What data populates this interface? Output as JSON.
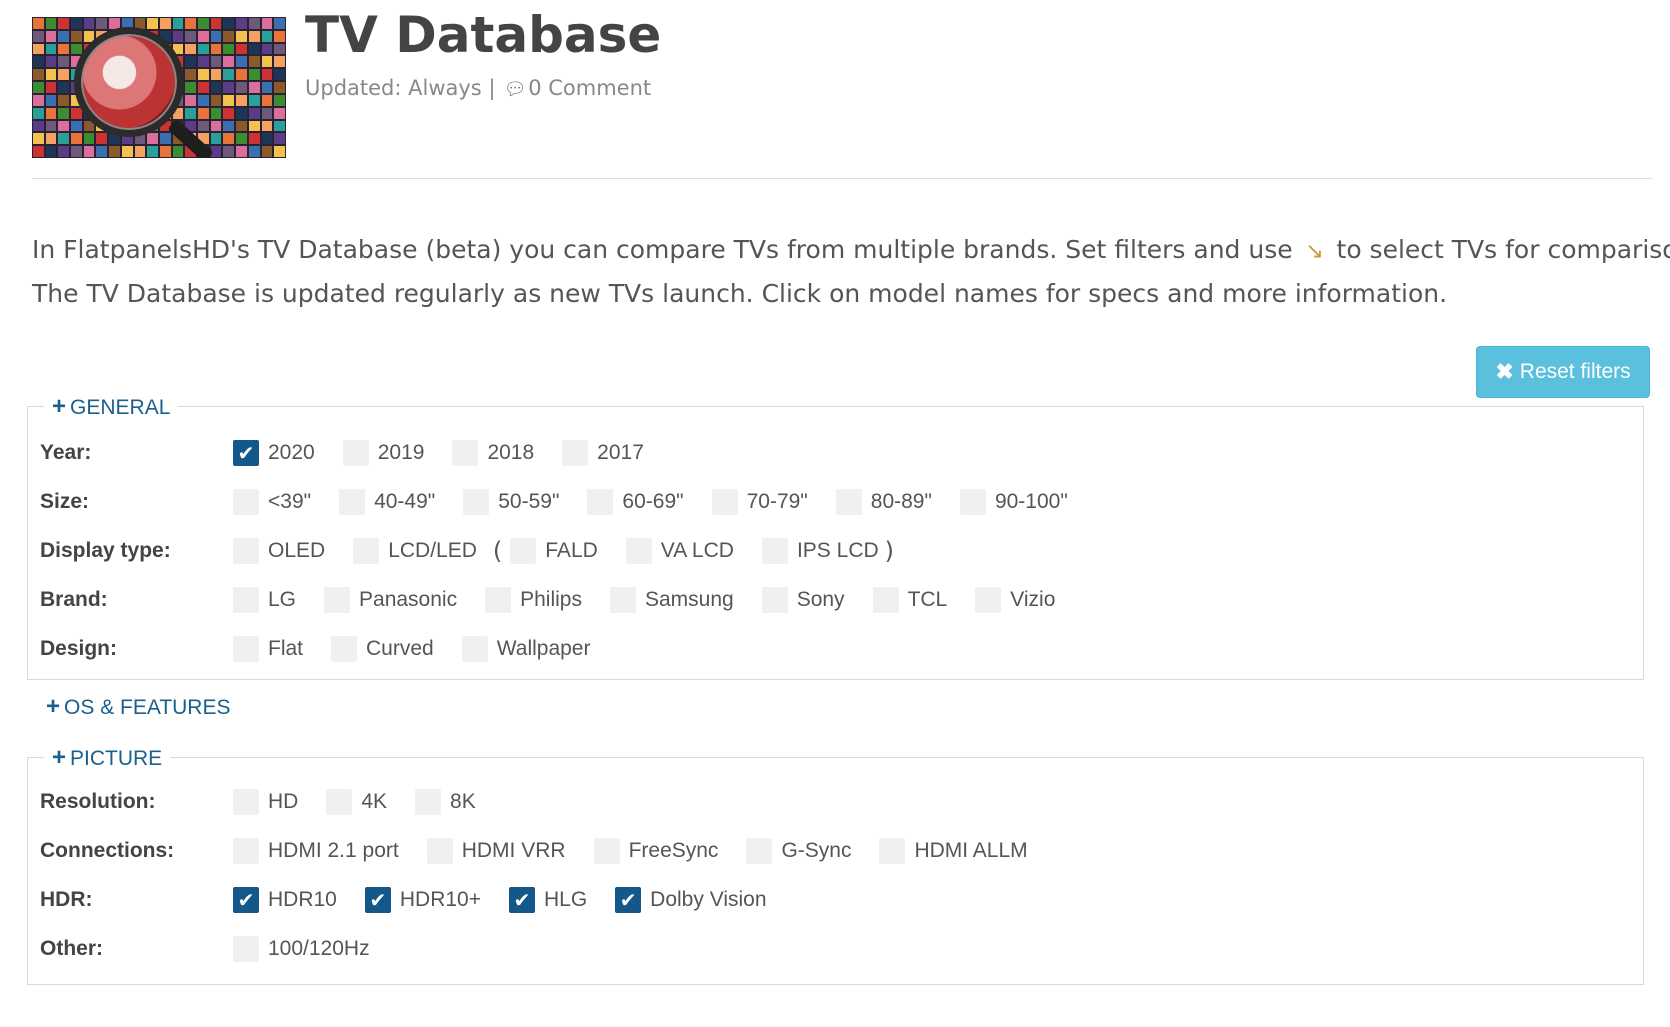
{
  "page": {
    "title": "TV Database",
    "updated_label": "Updated: Always",
    "separator": "|",
    "comment_icon": "comments-icon",
    "comments": "0 Comment"
  },
  "intro": {
    "part1": "In FlatpanelsHD's TV Database (beta) you can compare TVs from multiple brands. Set filters and use",
    "pin_icon": "pin-icon",
    "part2": "to select TVs for comparison.",
    "line2": "The TV Database is updated regularly as new TVs launch. Click on model names for specs and more information."
  },
  "reset_button": {
    "icon": "close-icon",
    "label": "Reset filters"
  },
  "sections": {
    "general": {
      "title": "GENERAL",
      "rows": {
        "year": {
          "label": "Year:",
          "options": [
            {
              "text": "2020",
              "checked": true
            },
            {
              "text": "2019",
              "checked": false
            },
            {
              "text": "2018",
              "checked": false
            },
            {
              "text": "2017",
              "checked": false
            }
          ]
        },
        "size": {
          "label": "Size:",
          "options": [
            {
              "text": "<39\"",
              "checked": false
            },
            {
              "text": "40-49\"",
              "checked": false
            },
            {
              "text": "50-59\"",
              "checked": false
            },
            {
              "text": "60-69\"",
              "checked": false
            },
            {
              "text": "70-79\"",
              "checked": false
            },
            {
              "text": "80-89\"",
              "checked": false
            },
            {
              "text": "90-100\"",
              "checked": false
            }
          ]
        },
        "display_type": {
          "label": "Display type:",
          "options": [
            {
              "text": "OLED",
              "checked": false
            },
            {
              "text": "LCD/LED",
              "checked": false
            }
          ],
          "paren_open": "(",
          "paren_close": ")",
          "sub_options": [
            {
              "text": "FALD",
              "checked": false
            },
            {
              "text": "VA LCD",
              "checked": false
            },
            {
              "text": "IPS LCD",
              "checked": false
            }
          ]
        },
        "brand": {
          "label": "Brand:",
          "options": [
            {
              "text": "LG",
              "checked": false
            },
            {
              "text": "Panasonic",
              "checked": false
            },
            {
              "text": "Philips",
              "checked": false
            },
            {
              "text": "Samsung",
              "checked": false
            },
            {
              "text": "Sony",
              "checked": false
            },
            {
              "text": "TCL",
              "checked": false
            },
            {
              "text": "Vizio",
              "checked": false
            }
          ]
        },
        "design": {
          "label": "Design:",
          "options": [
            {
              "text": "Flat",
              "checked": false
            },
            {
              "text": "Curved",
              "checked": false
            },
            {
              "text": "Wallpaper",
              "checked": false
            }
          ]
        }
      }
    },
    "os_features": {
      "title": "OS & FEATURES"
    },
    "picture": {
      "title": "PICTURE",
      "rows": {
        "resolution": {
          "label": "Resolution:",
          "options": [
            {
              "text": "HD",
              "checked": false
            },
            {
              "text": "4K",
              "checked": false
            },
            {
              "text": "8K",
              "checked": false
            }
          ]
        },
        "connections": {
          "label": "Connections:",
          "options": [
            {
              "text": "HDMI 2.1 port",
              "checked": false
            },
            {
              "text": "HDMI VRR",
              "checked": false
            },
            {
              "text": "FreeSync",
              "checked": false
            },
            {
              "text": "G-Sync",
              "checked": false
            },
            {
              "text": "HDMI ALLM",
              "checked": false
            }
          ]
        },
        "hdr": {
          "label": "HDR:",
          "options": [
            {
              "text": "HDR10",
              "checked": true
            },
            {
              "text": "HDR10+",
              "checked": true
            },
            {
              "text": "HLG",
              "checked": true
            },
            {
              "text": "Dolby Vision",
              "checked": true
            }
          ]
        },
        "other": {
          "label": "Other:",
          "options": [
            {
              "text": "100/120Hz",
              "checked": false
            }
          ]
        }
      }
    }
  },
  "colors": {
    "accent": "#14578a",
    "section_title": "#1b5f8c",
    "reset_button_bg": "#5bc0de",
    "checkbox_off": "#f0f0f0",
    "pin_icon": "#c8972e"
  }
}
